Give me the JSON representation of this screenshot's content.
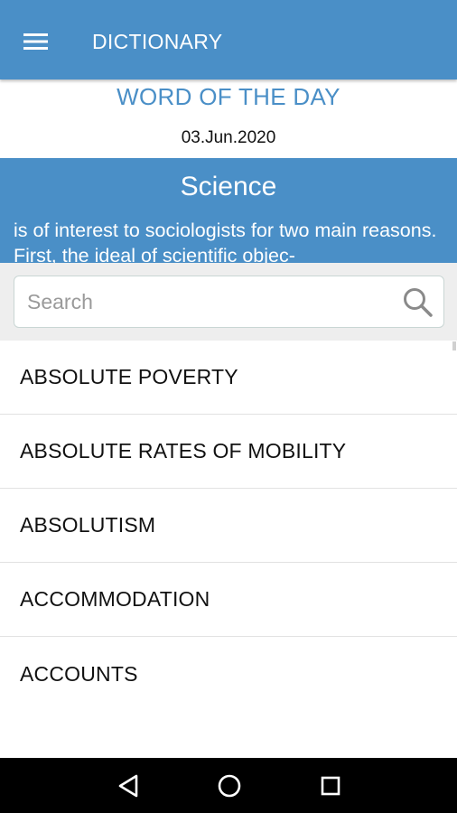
{
  "app_bar": {
    "title": "DICTIONARY",
    "menu_icon": "hamburger-menu-icon",
    "color": "#4a8fc7"
  },
  "word_of_day": {
    "heading": "WORD OF THE DAY",
    "date": "03.Jun.2020",
    "word": "Science",
    "definition": "is of interest to sociologists for two main reasons. First, the ideal of scientific objec-"
  },
  "search": {
    "placeholder": "Search",
    "value": "",
    "icon": "search-icon"
  },
  "word_list": {
    "items": [
      {
        "label": "ABSOLUTE POVERTY"
      },
      {
        "label": "ABSOLUTE RATES OF MOBILITY"
      },
      {
        "label": "ABSOLUTISM"
      },
      {
        "label": "ACCOMMODATION"
      },
      {
        "label": "ACCOUNTS"
      }
    ]
  },
  "nav_bar": {
    "back_icon": "back-triangle-icon",
    "home_icon": "home-circle-icon",
    "recents_icon": "recents-square-icon"
  }
}
